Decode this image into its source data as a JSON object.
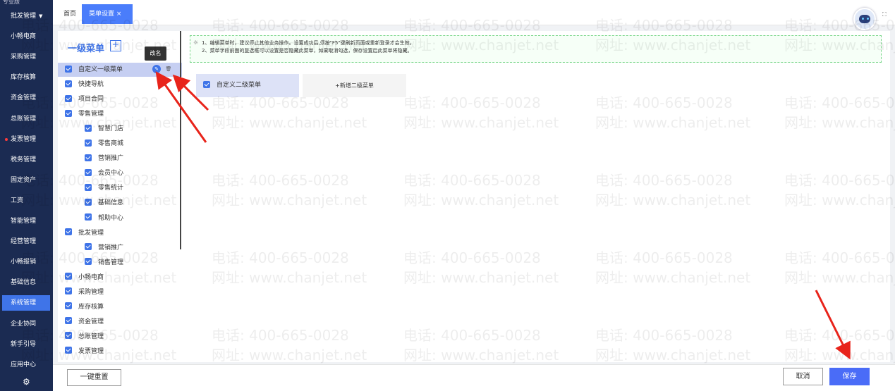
{
  "sidebar": {
    "logo": "专业版",
    "items": [
      "批发管理",
      "小畅电商",
      "采购管理",
      "库存核算",
      "资金管理",
      "总账管理",
      "发票管理",
      "税务管理",
      "固定资产",
      "工资",
      "智能管理",
      "经营管理",
      "小畅报销",
      "基础信息",
      "系统管理",
      "企业协同",
      "新手引导",
      "应用中心"
    ],
    "active_index": 14
  },
  "tabs": {
    "home": "首页",
    "menu_settings": "菜单设置",
    "close": "×"
  },
  "left_panel": {
    "title": "一级菜单",
    "add": "+",
    "tooltip": "改名",
    "items": [
      {
        "label": "自定义一级菜单",
        "level": 1,
        "selected": true
      },
      {
        "label": "快捷导航",
        "level": 1
      },
      {
        "label": "项目合同",
        "level": 1
      },
      {
        "label": "零售管理",
        "level": 1
      },
      {
        "label": "智慧门店",
        "level": 2
      },
      {
        "label": "零售商城",
        "level": 2
      },
      {
        "label": "营销推广",
        "level": 2
      },
      {
        "label": "会员中心",
        "level": 2
      },
      {
        "label": "零售统计",
        "level": 2
      },
      {
        "label": "基础信息",
        "level": 2
      },
      {
        "label": "帮助中心",
        "level": 2
      },
      {
        "label": "批发管理",
        "level": 1
      },
      {
        "label": "营销推广",
        "level": 2
      },
      {
        "label": "销售管理",
        "level": 2
      },
      {
        "label": "小畅电商",
        "level": 1
      },
      {
        "label": "采购管理",
        "level": 1
      },
      {
        "label": "库存核算",
        "level": 1
      },
      {
        "label": "资金管理",
        "level": 1
      },
      {
        "label": "总账管理",
        "level": 1
      },
      {
        "label": "发票管理",
        "level": 1
      }
    ]
  },
  "notice": {
    "line1": "1、编辑菜单时，建议停止其他业务操作。设置成功后,须按\"F5\"键刷新页面或重新登录才会生效。",
    "line2": "2、菜单字段前面的复选框可以设置是否隐藏此菜单，如果取消勾选，保存设置后此菜单将隐藏。"
  },
  "submenu": {
    "item": "自定义二级菜单",
    "add": "+新增二级菜单"
  },
  "footer": {
    "reset": "一键重置",
    "cancel": "取消",
    "save": "保存"
  },
  "watermark": {
    "phone": "电话: 400-665-0028",
    "site": "网址: www.chanjet.net"
  },
  "colors": {
    "accent": "#3f74e8",
    "sidebar": "#1b2b52",
    "annotation": "#e8231a"
  }
}
